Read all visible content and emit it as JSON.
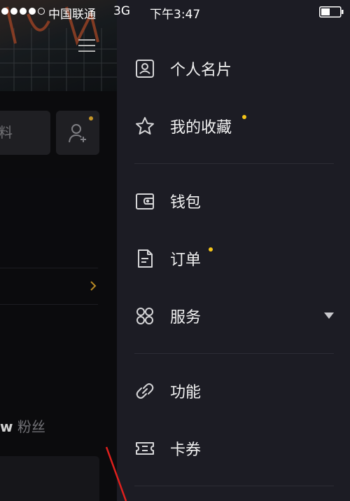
{
  "status_bar": {
    "carrier": "中国联通",
    "network": "3G",
    "time": "下午3:47"
  },
  "background_page": {
    "edit_button_label": "料",
    "fans_count": "w",
    "fans_label": "粉丝"
  },
  "drawer": {
    "items": [
      {
        "label": "个人名片",
        "icon": "id-card-icon"
      },
      {
        "label": "我的收藏",
        "icon": "star-icon",
        "badge": true
      },
      {
        "label": "钱包",
        "icon": "wallet-icon"
      },
      {
        "label": "订单",
        "icon": "order-icon",
        "badge": true
      },
      {
        "label": "服务",
        "icon": "service-icon",
        "expandable": true
      },
      {
        "label": "功能",
        "icon": "link-icon"
      },
      {
        "label": "卡券",
        "icon": "ticket-icon"
      }
    ]
  },
  "colors": {
    "drawer_bg": "#1c1c24",
    "badge": "#f5c518",
    "annotation": "#e0201d"
  }
}
